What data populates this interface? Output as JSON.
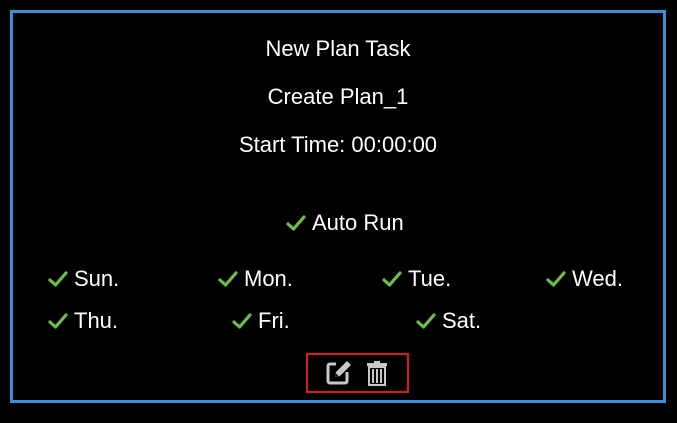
{
  "plan": {
    "heading": "New Plan Task",
    "name": "Create Plan_1",
    "start_time": "Start Time: 00:00:00",
    "auto_run_label": "Auto Run"
  },
  "days": {
    "sun": "Sun.",
    "mon": "Mon.",
    "tue": "Tue.",
    "wed": "Wed.",
    "thu": "Thu.",
    "fri": "Fri.",
    "sat": "Sat."
  },
  "checked": {
    "auto_run": true,
    "sun": true,
    "mon": true,
    "tue": true,
    "wed": true,
    "thu": true,
    "fri": true,
    "sat": true
  },
  "icons": {
    "check": "check-icon",
    "edit": "edit-icon",
    "delete": "trash-icon"
  },
  "colors": {
    "background": "#000000",
    "border": "#3a8fd6",
    "check": "#6cc04a",
    "text": "#ffffff",
    "action_highlight": "#e01818",
    "icon": "#c8c8c8"
  }
}
